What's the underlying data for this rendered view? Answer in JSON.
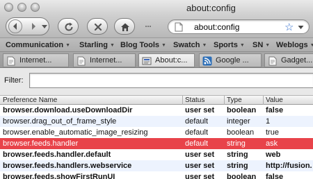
{
  "window": {
    "title": "about:config"
  },
  "navbar": {
    "url": "about:config",
    "icons": [
      "back-icon",
      "forward-icon",
      "reload-icon",
      "stop-icon",
      "home-icon",
      "bookmark-star-icon"
    ]
  },
  "bookmarks": [
    {
      "label": "Communication"
    },
    {
      "label": "Starling"
    },
    {
      "label": "Blog Tools"
    },
    {
      "label": "Swatch"
    },
    {
      "label": "Sports"
    },
    {
      "label": "SN"
    },
    {
      "label": "Weblogs"
    }
  ],
  "tabs": [
    {
      "label": "Internet..."
    },
    {
      "label": "Internet..."
    },
    {
      "label": "About:c..."
    },
    {
      "label": "Google ..."
    },
    {
      "label": "Gadget..."
    }
  ],
  "filter": {
    "label": "Filter:",
    "value": ""
  },
  "table": {
    "columns": [
      "Preference Name",
      "Status",
      "Type",
      "Value"
    ],
    "rows": [
      {
        "name": "browser.download.useDownloadDir",
        "status": "user set",
        "type": "boolean",
        "value": "false"
      },
      {
        "name": "browser.drag_out_of_frame_style",
        "status": "default",
        "type": "integer",
        "value": "1"
      },
      {
        "name": "browser.enable_automatic_image_resizing",
        "status": "default",
        "type": "boolean",
        "value": "true"
      },
      {
        "name": "browser.feeds.handler",
        "status": "default",
        "type": "string",
        "value": "ask"
      },
      {
        "name": "browser.feeds.handler.default",
        "status": "user set",
        "type": "string",
        "value": "web"
      },
      {
        "name": "browser.feeds.handlers.webservice",
        "status": "user set",
        "type": "string",
        "value": "http://fusion."
      },
      {
        "name": "browser.feeds.showFirstRunUI",
        "status": "user set",
        "type": "boolean",
        "value": "false"
      }
    ]
  },
  "colors": {
    "selected_row": "#e8434a",
    "alt_row": "#edf3fe",
    "star": "#2f6bcb"
  }
}
